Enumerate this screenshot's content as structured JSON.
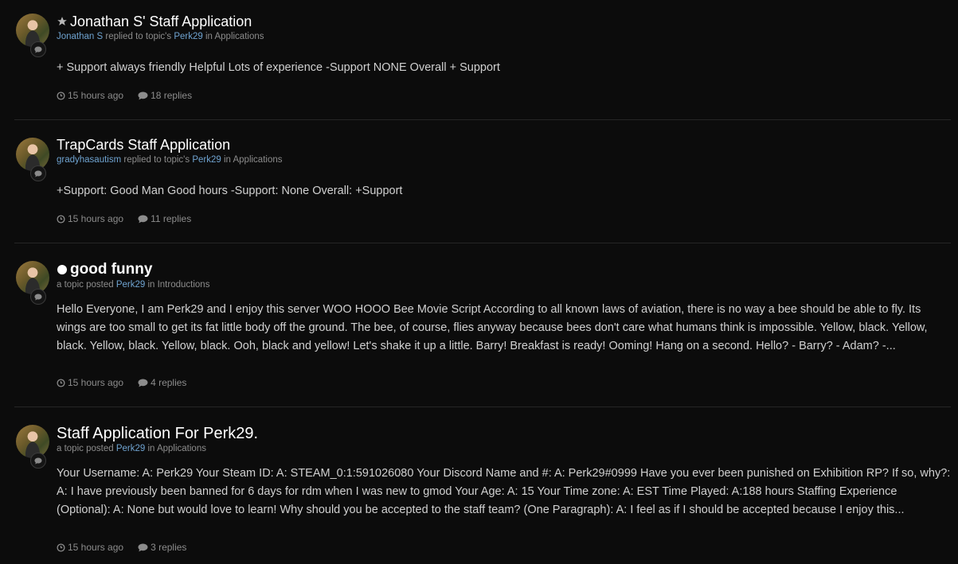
{
  "feed": {
    "items": [
      {
        "title": "Jonathan S' Staff Application",
        "title_icon": "star-icon",
        "meta_user": "Jonathan S",
        "meta_mid": " replied to topic's ",
        "meta_author": "Perk29",
        "meta_in": " in ",
        "meta_forum": "Applications",
        "body": "+ Support always friendly Helpful Lots of experience -Support NONE Overall + Support",
        "time": "15 hours ago",
        "replies": "18 replies"
      },
      {
        "title": "TrapCards Staff Application",
        "meta_user": "gradyhasautism",
        "meta_mid": " replied to topic's ",
        "meta_author": "Perk29",
        "meta_in": " in ",
        "meta_forum": "Applications",
        "body": "+Support: Good Man Good hours -Support: None Overall: +Support",
        "time": "15 hours ago",
        "replies": "11 replies"
      },
      {
        "title": "good funny",
        "title_icon": "unread-dot-icon",
        "meta_prefix": "a topic posted ",
        "meta_author": "Perk29",
        "meta_in": " in ",
        "meta_forum": "Introductions",
        "body": "Hello Everyone, I am Perk29 and I enjoy this server WOO HOOO Bee Movie Script According to all known laws of aviation, there is no way a bee should be able to fly. Its wings are too small to get its fat little body off the ground. The bee, of course, flies anyway because bees don't care what humans think is impossible. Yellow, black. Yellow, black. Yellow, black. Yellow, black. Ooh, black and yellow! Let's shake it up a little. Barry! Breakfast is ready! Ooming! Hang on a second. Hello? - Barry? - Adam? -...",
        "time": "15 hours ago",
        "replies": "4 replies"
      },
      {
        "title": "Staff Application For Perk29.",
        "meta_prefix": "a topic posted ",
        "meta_author": "Perk29",
        "meta_in": " in ",
        "meta_forum": "Applications",
        "body": "Your Username: A: Perk29 Your Steam ID: A: STEAM_0:1:591026080 Your Discord Name and #: A: Perk29#0999 Have you ever been punished on Exhibition RP? If so, why?: A: I have previously been banned for 6 days for rdm when I was new to gmod Your Age: A: 15 Your Time zone: A: EST Time Played: A:188 hours Staffing Experience (Optional): A: None but would love to learn! Why should you be accepted to the staff team? (One Paragraph): A: I feel as if I should be accepted because I enjoy this...",
        "time": "15 hours ago",
        "replies": "3 replies"
      }
    ]
  }
}
